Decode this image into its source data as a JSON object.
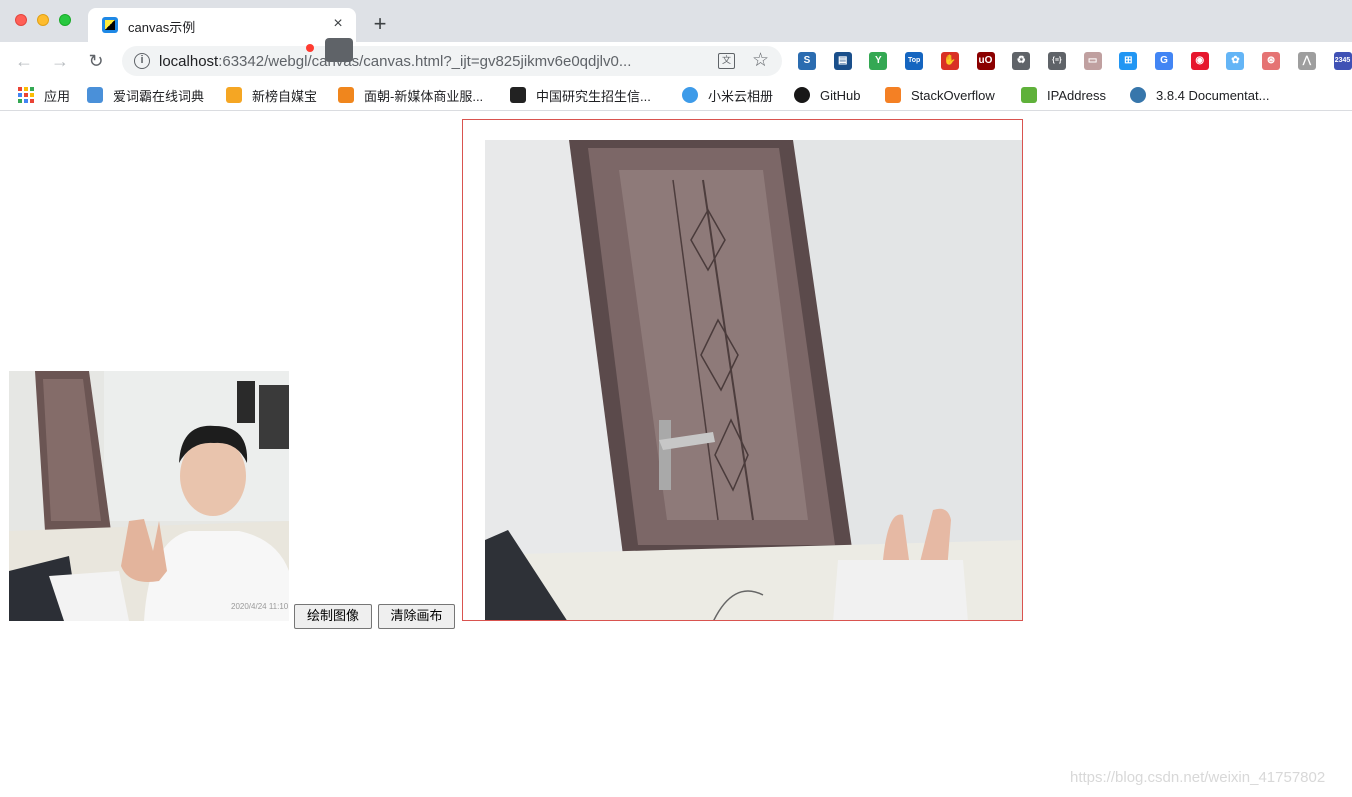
{
  "tab": {
    "title": "canvas示例",
    "close_glyph": "×",
    "new_tab_glyph": "+"
  },
  "toolbar": {
    "back_glyph": "←",
    "forward_glyph": "→",
    "reload_glyph": "↻",
    "url_host": "localhost",
    "url_rest": ":63342/webgl/canvas/canvas.html?_ijt=gv825jikmv6e0qdjlv0...",
    "info_glyph": "i",
    "translate_glyph": "文",
    "star_glyph": "☆",
    "extensions": [
      {
        "name": "extension-s-icon",
        "color": "#2b6cb0",
        "glyph": "S"
      },
      {
        "name": "extension-window-icon",
        "color": "#1a4f8b",
        "glyph": "▤"
      },
      {
        "name": "extension-y-icon",
        "color": "#34a853",
        "glyph": "Y"
      },
      {
        "name": "extension-tophub-icon",
        "color": "#1565c0",
        "glyph": "Top"
      },
      {
        "name": "extension-hand-icon",
        "color": "#d93025",
        "glyph": "✋"
      },
      {
        "name": "extension-ublock-icon",
        "color": "#8b0000",
        "glyph": "uO"
      },
      {
        "name": "extension-recycle-icon",
        "color": "#5f6368",
        "glyph": "♻"
      },
      {
        "name": "extension-json-icon",
        "color": "#5f6368",
        "glyph": "{≡}"
      },
      {
        "name": "extension-reader-icon",
        "color": "#c0a0a0",
        "glyph": "▭"
      },
      {
        "name": "extension-grid-icon",
        "color": "#2196f3",
        "glyph": "⊞"
      },
      {
        "name": "extension-translate-icon",
        "color": "#4285f4",
        "glyph": "G"
      },
      {
        "name": "extension-weibo-icon",
        "color": "#e6162d",
        "glyph": "◉"
      },
      {
        "name": "extension-flower-icon",
        "color": "#64b5f6",
        "glyph": "✿"
      },
      {
        "name": "extension-network-icon",
        "color": "#e57373",
        "glyph": "⊛"
      },
      {
        "name": "extension-mountain-icon",
        "color": "#9e9e9e",
        "glyph": "⋀"
      },
      {
        "name": "extension-badge-icon",
        "color": "#3f51b5",
        "glyph": "2345"
      }
    ]
  },
  "bookmarks": [
    {
      "label": "应用",
      "icon": "apps-icon",
      "color": "#ea4335"
    },
    {
      "label": "爱词霸在线词典",
      "icon": "iciba-icon",
      "color": "#4a90d9"
    },
    {
      "label": "新榜自媒宝",
      "icon": "newrank-icon",
      "color": "#f5a623"
    },
    {
      "label": "面朝-新媒体商业服...",
      "icon": "mianchao-icon",
      "color": "#f0861d"
    },
    {
      "label": "中国研究生招生信...",
      "icon": "graduate-cap-icon",
      "color": "#222222"
    },
    {
      "label": "小米云相册",
      "icon": "cloud-icon",
      "color": "#3d9be9"
    },
    {
      "label": "GitHub",
      "icon": "github-icon",
      "color": "#181717"
    },
    {
      "label": "StackOverflow",
      "icon": "stackoverflow-icon",
      "color": "#f48024"
    },
    {
      "label": "IPAddress",
      "icon": "ipaddress-icon",
      "color": "#5fb13a"
    },
    {
      "label": "3.8.4 Documentat...",
      "icon": "python-icon",
      "color": "#3776ab"
    }
  ],
  "page": {
    "draw_button": "绘制图像",
    "clear_button": "清除画布",
    "video_timestamp": "2020/4/24 11:10"
  },
  "watermark": "https://blog.csdn.net/weixin_41757802"
}
